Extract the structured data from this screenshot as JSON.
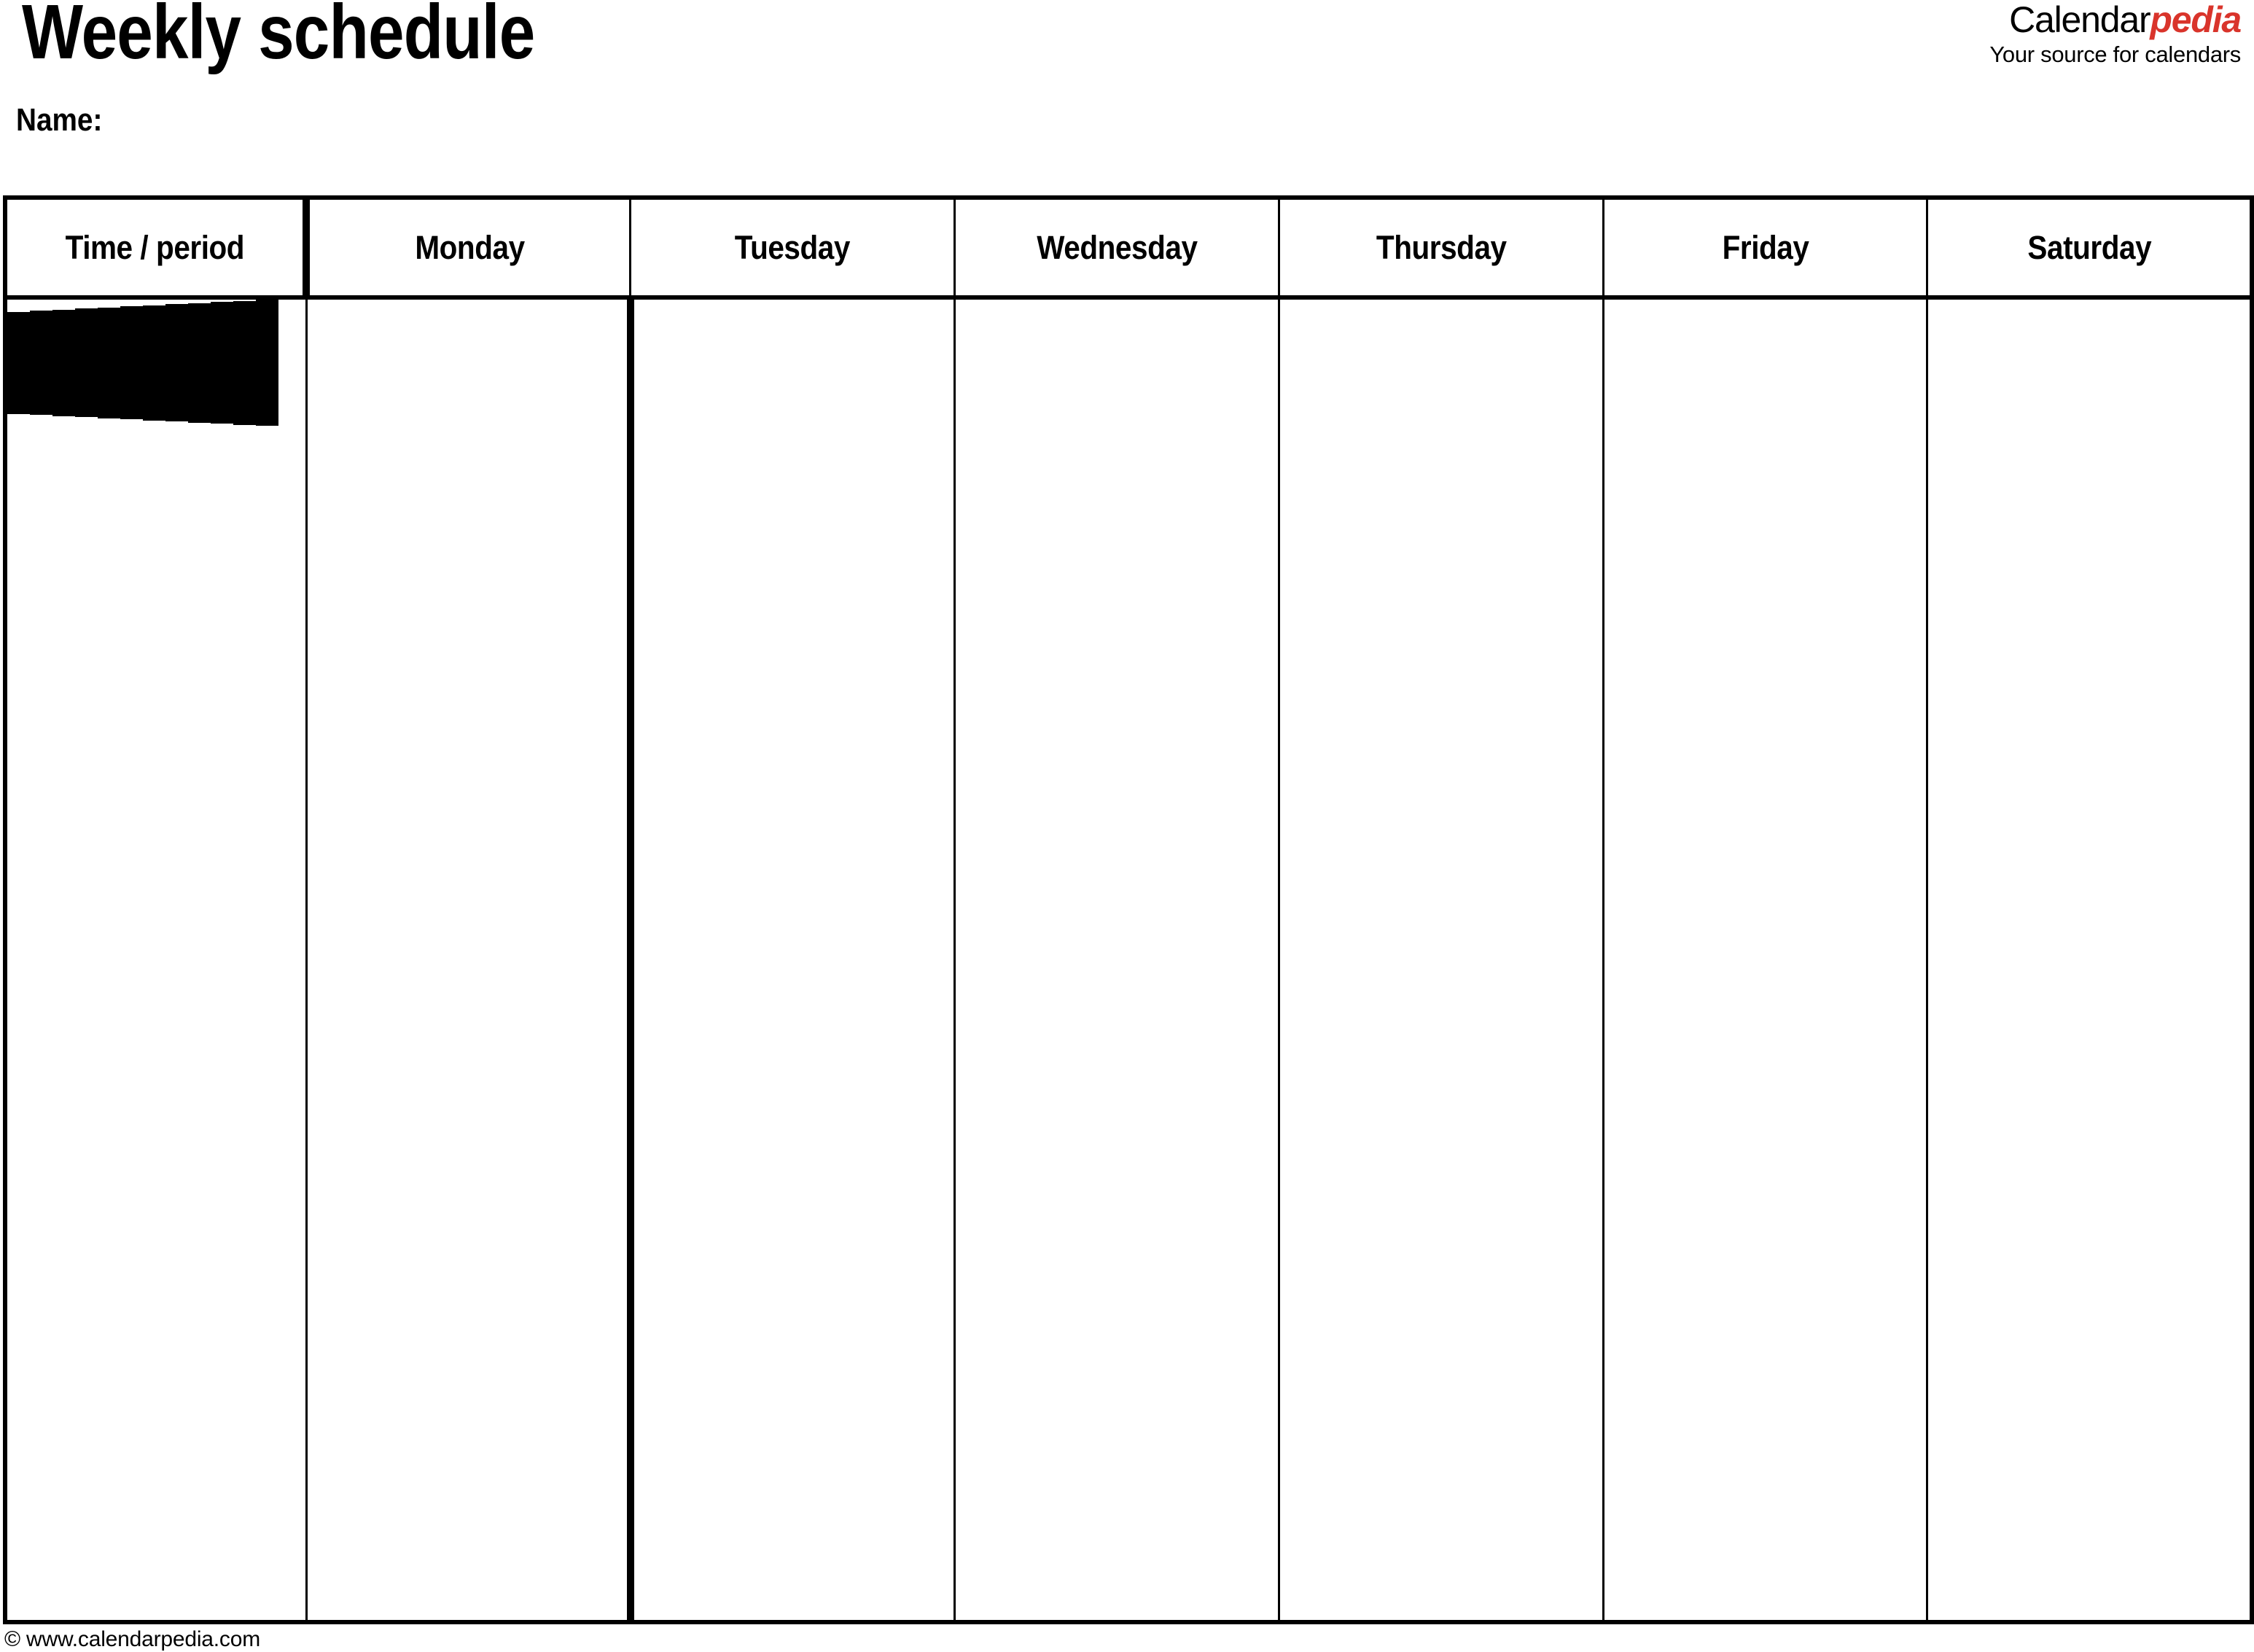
{
  "document": {
    "title": "Weekly schedule",
    "name_label": "Name:",
    "name_value": ""
  },
  "logo": {
    "word_black": "Calendar",
    "word_red": "pedia",
    "tagline": "Your source for calendars",
    "accent_color": "#d9342b",
    "text_color": "#000000"
  },
  "table": {
    "columns": [
      "Time / period",
      "Monday",
      "Tuesday",
      "Wednesday",
      "Thursday",
      "Friday",
      "Saturday"
    ],
    "row_count": 13,
    "rows": [
      [
        "",
        "",
        "",
        "",
        "",
        "",
        ""
      ],
      [
        "",
        "",
        "",
        "",
        "",
        "",
        ""
      ],
      [
        "",
        "",
        "",
        "",
        "",
        "",
        ""
      ],
      [
        "",
        "",
        "",
        "",
        "",
        "",
        ""
      ],
      [
        "",
        "",
        "",
        "",
        "",
        "",
        ""
      ],
      [
        "",
        "",
        "",
        "",
        "",
        "",
        ""
      ],
      [
        "",
        "",
        "",
        "",
        "",
        "",
        ""
      ],
      [
        "",
        "",
        "",
        "",
        "",
        "",
        ""
      ],
      [
        "",
        "",
        "",
        "",
        "",
        "",
        ""
      ],
      [
        "",
        "",
        "",
        "",
        "",
        "",
        ""
      ],
      [
        "",
        "",
        "",
        "",
        "",
        "",
        ""
      ],
      [
        "",
        "",
        "",
        "",
        "",
        "",
        ""
      ],
      [
        "",
        "",
        "",
        "",
        "",
        "",
        ""
      ]
    ]
  },
  "footer": {
    "copyright": "© www.calendarpedia.com"
  }
}
